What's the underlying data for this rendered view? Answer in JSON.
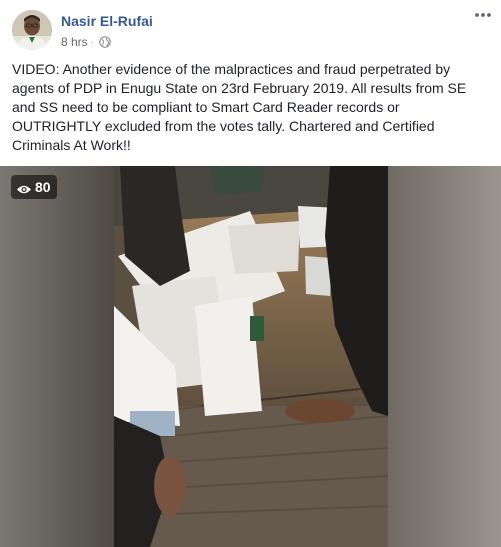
{
  "post": {
    "author_name": "Nasir El-Rufai",
    "timestamp": "8 hrs",
    "separator": "·",
    "audience_icon": "globe-icon",
    "more_icon": "more-dots-icon",
    "text": "VIDEO: Another evidence of the malpractices and fraud perpetrated by agents of PDP in Enugu State on 23rd February 2019. All results from SE and SS need to be compliant to Smart Card Reader records or OUTRIGHTLY excluded from the votes tally. Chartered and Certified Criminals At Work!!"
  },
  "video": {
    "view_count": "80",
    "view_icon": "eye-icon"
  },
  "colors": {
    "author_link": "#365899",
    "meta_text": "#616770",
    "body_text": "#1d2129"
  }
}
